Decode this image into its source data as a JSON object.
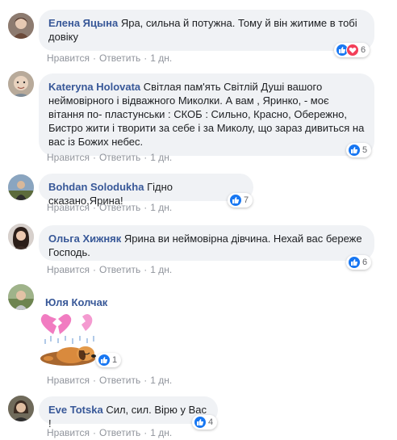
{
  "labels": {
    "like": "Нравится",
    "reply": "Ответить",
    "separator": "·"
  },
  "comments": [
    {
      "author": "Елена Яцына",
      "text": "Яра, сильна й потужна. Тому й він житиме в тобі довіку",
      "time": "1 дн.",
      "reactions": "6",
      "reaction_types": [
        "like-icon",
        "love-icon"
      ]
    },
    {
      "author": "Kateryna Holovata",
      "text": "Світлая пам'ять Світлій Душі вашого неймовірного і відважного Миколки. А вам , Яринко, - моє вітання по- пластунськи : СКОБ : Сильно, Красно, Обережно, Бистро жити і творити за себе і за Миколу, що зараз дивиться на вас із Божих небес.",
      "time": "1 дн.",
      "reactions": "5",
      "reaction_types": [
        "like-icon"
      ]
    },
    {
      "author": "Bohdan Solodukha",
      "text": "Гідно сказано,Ярина!",
      "time": "1 дн.",
      "reactions": "7",
      "reaction_types": [
        "like-icon"
      ]
    },
    {
      "author": "Ольга Хижняк",
      "text": "Ярина ви неймовірна дівчина. Нехай вас береже Господь.",
      "time": "1 дн.",
      "reactions": "6",
      "reaction_types": [
        "like-icon"
      ]
    },
    {
      "author": "Юля Колчак",
      "text": "",
      "time": "1 дн.",
      "reactions": "1",
      "reaction_types": [
        "like-icon"
      ],
      "sticker": "broken-heart-crying-dog-sticker"
    },
    {
      "author": "Eve Totska",
      "text": "Сил, сил. Вірю у Вас !",
      "time": "1 дн.",
      "reactions": "4",
      "reaction_types": [
        "like-icon"
      ]
    }
  ],
  "colors": {
    "author": "#385898",
    "bubble": "#f0f2f5",
    "meta": "#90949c",
    "like": "#1877f2",
    "love": "#f33e58"
  }
}
